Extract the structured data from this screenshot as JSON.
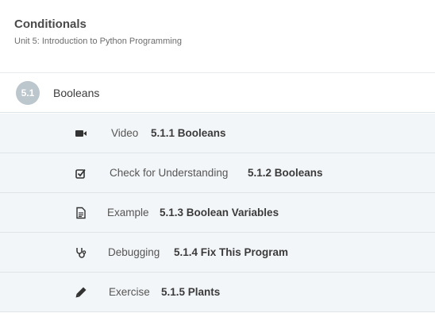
{
  "header": {
    "title": "Conditionals",
    "subtitle": "Unit 5: Introduction to Python Programming"
  },
  "section": {
    "number": "5.1",
    "title": "Booleans"
  },
  "items": [
    {
      "type": "Video",
      "name": "5.1.1 Booleans",
      "icon": "video-camera-icon"
    },
    {
      "type": "Check for Understanding",
      "name": "5.1.2 Booleans",
      "icon": "checkbox-icon"
    },
    {
      "type": "Example",
      "name": "5.1.3 Boolean Variables",
      "icon": "document-icon"
    },
    {
      "type": "Debugging",
      "name": "5.1.4 Fix This Program",
      "icon": "stethoscope-icon"
    },
    {
      "type": "Exercise",
      "name": "5.1.5 Plants",
      "icon": "pencil-icon"
    }
  ],
  "colors": {
    "badge": "#bcc6cd",
    "row_background": "#f3f6f8",
    "divider": "#dfe4e8"
  }
}
